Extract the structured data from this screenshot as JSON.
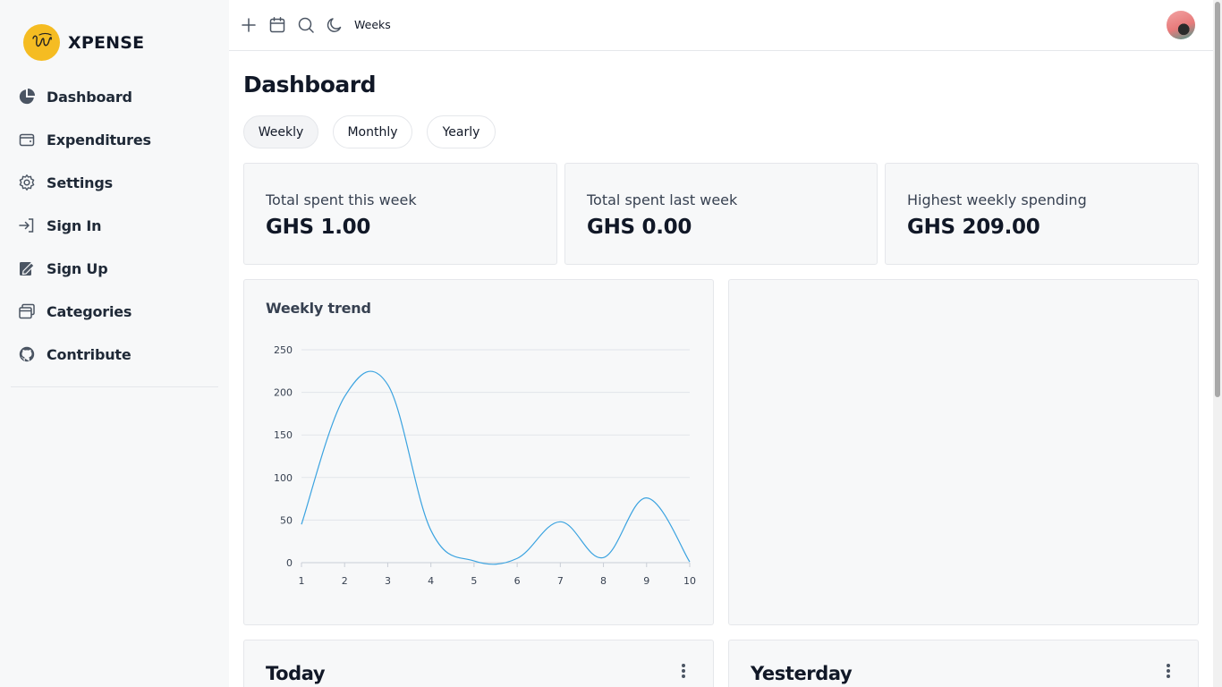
{
  "app": {
    "brand_name": "XPENSE"
  },
  "sidebar": {
    "items": [
      {
        "label": "Dashboard",
        "icon": "pie-chart-icon"
      },
      {
        "label": "Expenditures",
        "icon": "wallet-icon"
      },
      {
        "label": "Settings",
        "icon": "gear-icon"
      },
      {
        "label": "Sign In",
        "icon": "sign-in-icon"
      },
      {
        "label": "Sign Up",
        "icon": "signup-icon"
      },
      {
        "label": "Categories",
        "icon": "categories-icon"
      },
      {
        "label": "Contribute",
        "icon": "github-icon"
      }
    ]
  },
  "topbar": {
    "period_label": "Weeks"
  },
  "main": {
    "title": "Dashboard",
    "tabs": [
      {
        "label": "Weekly",
        "active": true
      },
      {
        "label": "Monthly",
        "active": false
      },
      {
        "label": "Yearly",
        "active": false
      }
    ],
    "stats": [
      {
        "label": "Total spent this week",
        "value": "GHS 1.00"
      },
      {
        "label": "Total spent last week",
        "value": "GHS 0.00"
      },
      {
        "label": "Highest weekly spending",
        "value": "GHS 209.00"
      }
    ],
    "day_cards": [
      {
        "title": "Today"
      },
      {
        "title": "Yesterday"
      }
    ]
  },
  "colors": {
    "accent": "#3ba3e0",
    "logo": "#f5bc22",
    "card_bg": "#f7f8f9"
  },
  "chart_data": {
    "type": "line",
    "title": "Weekly trend",
    "x": [
      1,
      2,
      3,
      4,
      5,
      6,
      7,
      8,
      9,
      10
    ],
    "values": [
      45,
      195,
      209,
      38,
      2,
      5,
      48,
      6,
      76,
      1
    ],
    "y_ticks": [
      0,
      50,
      100,
      150,
      200,
      250
    ],
    "ylim": [
      0,
      250
    ],
    "grid": true,
    "color": "#3ba3e0"
  }
}
